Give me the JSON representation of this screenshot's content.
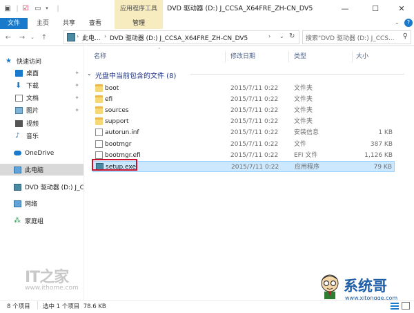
{
  "window": {
    "title": "DVD 驱动器 (D:) J_CCSA_X64FRE_ZH-CN_DV5",
    "context_tab_header": "应用程序工具"
  },
  "ribbon": {
    "tabs": [
      "文件",
      "主页",
      "共享",
      "查看",
      "管理"
    ]
  },
  "address": {
    "path": [
      "此电...",
      "DVD 驱动器 (D:) J_CCSA_X64FRE_ZH-CN_DV5"
    ],
    "search_placeholder": "搜索\"DVD 驱动器 (D:) J_CCS..."
  },
  "nav": {
    "quick_access": "快速访问",
    "pinned": [
      "桌面",
      "下载",
      "文档",
      "图片"
    ],
    "items": [
      "视频",
      "音乐"
    ],
    "onedrive": "OneDrive",
    "this_pc": "此电脑",
    "drive": "DVD 驱动器 (D:) J_C",
    "network": "网络",
    "homegroup": "家庭组"
  },
  "columns": {
    "name": "名称",
    "date": "修改日期",
    "type": "类型",
    "size": "大小"
  },
  "group_label": "光盘中当前包含的文件 (8)",
  "files": [
    {
      "name": "boot",
      "date": "2015/7/11 0:22",
      "type": "文件夹",
      "size": "",
      "icon": "folder"
    },
    {
      "name": "efi",
      "date": "2015/7/11 0:22",
      "type": "文件夹",
      "size": "",
      "icon": "folder"
    },
    {
      "name": "sources",
      "date": "2015/7/11 0:22",
      "type": "文件夹",
      "size": "",
      "icon": "folder"
    },
    {
      "name": "support",
      "date": "2015/7/11 0:22",
      "type": "文件夹",
      "size": "",
      "icon": "folder"
    },
    {
      "name": "autorun.inf",
      "date": "2015/7/11 0:22",
      "type": "安装信息",
      "size": "1 KB",
      "icon": "settings-file"
    },
    {
      "name": "bootmgr",
      "date": "2015/7/11 0:22",
      "type": "文件",
      "size": "387 KB",
      "icon": "file"
    },
    {
      "name": "bootmgr.efi",
      "date": "2015/7/11 0:22",
      "type": "EFI 文件",
      "size": "1,126 KB",
      "icon": "file"
    },
    {
      "name": "setup.exe",
      "date": "2015/7/11 0:22",
      "type": "应用程序",
      "size": "79 KB",
      "icon": "exe"
    }
  ],
  "status": {
    "count": "8 个项目",
    "selection": "选中 1 个项目  78.6 KB"
  },
  "watermarks": {
    "ithome_logo": "IT之家",
    "ithome_url": "www.ithome.com",
    "brand": "系统哥",
    "brand_url": "www.xitongge.com"
  },
  "colors": {
    "accent": "#1979ca",
    "context_tab": "#f7ecbf",
    "selection": "#cce8ff",
    "highlight_box": "#c8102e"
  }
}
